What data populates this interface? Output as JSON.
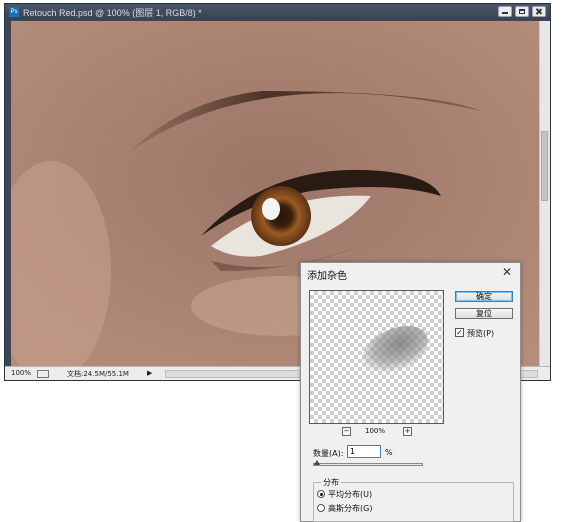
{
  "document": {
    "title": "Retouch Red.psd @ 100% (图层 1, RGB/8) *",
    "app_icon": "Ps",
    "window_buttons": [
      "minimize-icon",
      "maximize-icon",
      "close-icon"
    ]
  },
  "statusbar": {
    "zoom": "100%",
    "doc_info": "文档:24.5M/55.1M",
    "nav_arrow": "▶"
  },
  "dialog": {
    "title": "添加杂色",
    "close_glyph": "✕",
    "ok_label": "确定",
    "reset_label": "复位",
    "preview_label": "预览(P)",
    "preview_checked": true,
    "preview_zoom": "100%",
    "zoom_out_glyph": "−",
    "zoom_in_glyph": "+",
    "amount_label": "数量(A):",
    "amount_value": "1",
    "amount_unit": "%",
    "amount_fraction": 0.0,
    "distribution": {
      "title": "分布",
      "options": [
        "平均分布(U)",
        "高斯分布(G)"
      ],
      "selected": "平均分布(U)"
    },
    "check_glyph": "✓"
  },
  "colors": {
    "accent": "#3c7fb1",
    "window_chrome": "#3d4756",
    "skin_tone": "#a67f70"
  }
}
